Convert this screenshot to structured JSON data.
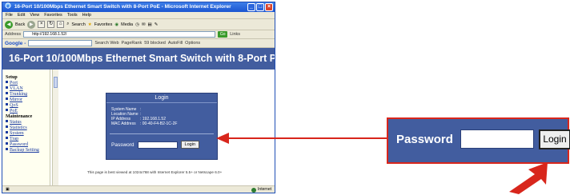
{
  "window": {
    "title": "16-Port 10/100Mbps Ethernet Smart Switch with 8-Port PoE - Microsoft Internet Explorer",
    "menu": [
      "File",
      "Edit",
      "View",
      "Favorites",
      "Tools",
      "Help"
    ],
    "toolbar": {
      "back": "Back",
      "search": "Search",
      "favorites": "Favorites",
      "media": "Media"
    },
    "address_label": "Address",
    "address_value": "http://192.168.1.52/",
    "go_label": "Go",
    "links_label": "Links",
    "google": {
      "logo": "Google -",
      "search_web": "Search Web",
      "pagerank": "PageRank",
      "blocked": "59 blocked",
      "autofill": "AutoFill",
      "options": "Options"
    },
    "status_zone": "Internet"
  },
  "page": {
    "banner": "16-Port 10/100Mbps Ethernet Smart Switch with 8-Port PoE",
    "sidebar": {
      "setup_heading": "Setup",
      "setup_items": [
        "Port",
        "VLAN",
        "Trunking",
        "Mirror",
        "QoS",
        "PoE"
      ],
      "maintenance_heading": "Maintenance",
      "maintenance_items": [
        "Status",
        "Statistics",
        "System",
        "Trap",
        "Password",
        "Backup Setting"
      ]
    },
    "login": {
      "title": "Login",
      "info": [
        {
          "key": "System Name",
          "value": ":"
        },
        {
          "key": "Location Name",
          "value": ":"
        },
        {
          "key": "IP Address",
          "value": ": 192.168.1.52"
        },
        {
          "key": "MAC Address",
          "value": ": 00-40-F4-B2-1C-2F"
        }
      ],
      "password_label": "Password",
      "login_button": "Login"
    },
    "best_viewed": "This page is best viewed at 1024x768 with Internet Explorer 5.5+ or Netscape 6.0+"
  },
  "zoom": {
    "password_label": "Password",
    "login_button": "Login"
  },
  "colors": {
    "banner": "#425d9f",
    "login_box": "#425d9f",
    "callout": "#d8261c",
    "link": "#1a3aa0"
  }
}
